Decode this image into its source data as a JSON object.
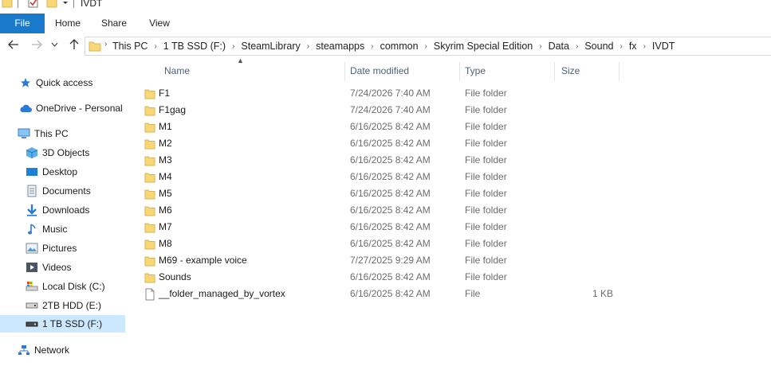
{
  "window": {
    "title": "IVDT"
  },
  "ribbon": {
    "tabs": [
      "File",
      "Home",
      "Share",
      "View"
    ]
  },
  "breadcrumb": [
    "This PC",
    "1 TB SSD (F:)",
    "SteamLibrary",
    "steamapps",
    "common",
    "Skyrim Special Edition",
    "Data",
    "Sound",
    "fx",
    "IVDT"
  ],
  "sidebar": {
    "items": [
      {
        "label": "Quick access",
        "icon": "star-icon"
      },
      {
        "label": "OneDrive - Personal",
        "icon": "cloud-icon"
      },
      {
        "label": "This PC",
        "icon": "computer-icon"
      },
      {
        "label": "3D Objects",
        "icon": "cube-icon"
      },
      {
        "label": "Desktop",
        "icon": "desktop-icon"
      },
      {
        "label": "Documents",
        "icon": "document-icon"
      },
      {
        "label": "Downloads",
        "icon": "download-icon"
      },
      {
        "label": "Music",
        "icon": "music-icon"
      },
      {
        "label": "Pictures",
        "icon": "pictures-icon"
      },
      {
        "label": "Videos",
        "icon": "video-icon"
      },
      {
        "label": "Local Disk (C:)",
        "icon": "system-drive-icon"
      },
      {
        "label": "2TB HDD (E:)",
        "icon": "drive-icon"
      },
      {
        "label": "1 TB SSD (F:)",
        "icon": "drive-icon"
      },
      {
        "label": "Network",
        "icon": "network-icon"
      }
    ]
  },
  "columns": {
    "name": "Name",
    "date": "Date modified",
    "type": "Type",
    "size": "Size"
  },
  "files": [
    {
      "name": "F1",
      "date": "7/24/2026 7:40 AM",
      "type": "File folder",
      "size": "",
      "icon": "folder-icon"
    },
    {
      "name": "F1gag",
      "date": "7/24/2026 7:40 AM",
      "type": "File folder",
      "size": "",
      "icon": "folder-icon"
    },
    {
      "name": "M1",
      "date": "6/16/2025 8:42 AM",
      "type": "File folder",
      "size": "",
      "icon": "folder-icon"
    },
    {
      "name": "M2",
      "date": "6/16/2025 8:42 AM",
      "type": "File folder",
      "size": "",
      "icon": "folder-icon"
    },
    {
      "name": "M3",
      "date": "6/16/2025 8:42 AM",
      "type": "File folder",
      "size": "",
      "icon": "folder-icon"
    },
    {
      "name": "M4",
      "date": "6/16/2025 8:42 AM",
      "type": "File folder",
      "size": "",
      "icon": "folder-icon"
    },
    {
      "name": "M5",
      "date": "6/16/2025 8:42 AM",
      "type": "File folder",
      "size": "",
      "icon": "folder-icon"
    },
    {
      "name": "M6",
      "date": "6/16/2025 8:42 AM",
      "type": "File folder",
      "size": "",
      "icon": "folder-icon"
    },
    {
      "name": "M7",
      "date": "6/16/2025 8:42 AM",
      "type": "File folder",
      "size": "",
      "icon": "folder-icon"
    },
    {
      "name": "M8",
      "date": "6/16/2025 8:42 AM",
      "type": "File folder",
      "size": "",
      "icon": "folder-icon"
    },
    {
      "name": "M69 - example voice",
      "date": "7/27/2025 9:29 AM",
      "type": "File folder",
      "size": "",
      "icon": "folder-icon"
    },
    {
      "name": "Sounds",
      "date": "6/16/2025 8:42 AM",
      "type": "File folder",
      "size": "",
      "icon": "folder-icon"
    },
    {
      "name": "__folder_managed_by_vortex",
      "date": "6/16/2025 8:42 AM",
      "type": "File",
      "size": "1 KB",
      "icon": "file-icon"
    }
  ],
  "colors": {
    "accent": "#1979ca",
    "selected": "#cce8ff",
    "folder": "#f8d775"
  }
}
